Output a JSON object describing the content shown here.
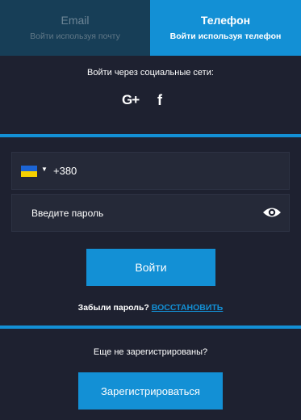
{
  "tabs": [
    {
      "title": "Email",
      "subtitle": "Войти используя почту",
      "active": false
    },
    {
      "title": "Телефон",
      "subtitle": "Войти используя телефон",
      "active": true
    }
  ],
  "social": {
    "label": "Войти через социальные сети:",
    "icons": [
      "google-plus-icon",
      "facebook-icon"
    ],
    "google_plus_glyph": "G+",
    "facebook_glyph": "f"
  },
  "phone": {
    "country_flag": "ukraine-flag",
    "caret_glyph": "▼",
    "value": "+380"
  },
  "password": {
    "placeholder": "Введите пароль",
    "toggle_icon": "eye-icon"
  },
  "login_button": "Войти",
  "forgot": {
    "text": "Забыли пароль?",
    "link": "ВОССТАНОВИТЬ"
  },
  "register": {
    "prompt": "Еще не зарегистрированы?",
    "button": "Зарегистрироваться"
  },
  "colors": {
    "accent": "#1390d5",
    "background": "#1e2130",
    "field_background": "#252938",
    "inactive_tab": "#173e57"
  }
}
